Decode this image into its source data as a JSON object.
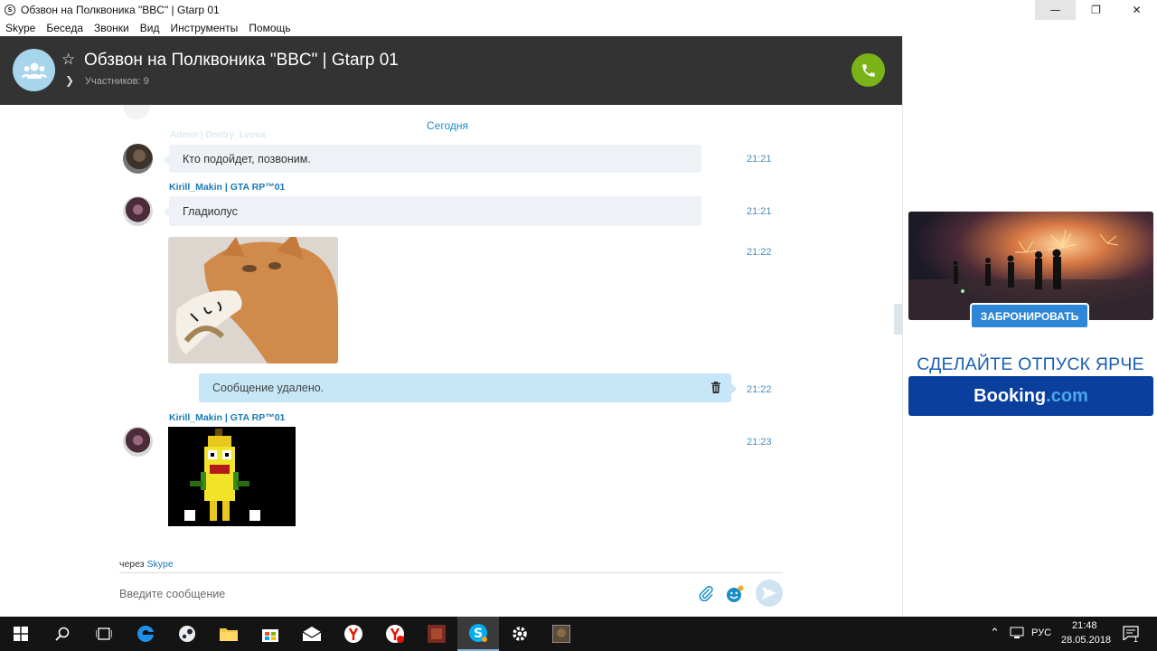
{
  "window": {
    "title": "Обзвон на Полквоника \"BBC\" | Gtarp 01"
  },
  "menu": [
    "Skype",
    "Беседа",
    "Звонки",
    "Вид",
    "Инструменты",
    "Помощь"
  ],
  "conversation": {
    "title": "Обзвон на Полквоника \"BBC\" | Gtarp 01",
    "participants": "Участников: 9"
  },
  "chat": {
    "faded_sender": "Admin | Dmitry_Lvova",
    "date_divider": "Сегодня",
    "messages": [
      {
        "text": "Кто подойдет, позвоним.",
        "time": "21:21"
      },
      {
        "sender": "Kirill_Makin | GTA RP™01",
        "text": "Гладиолус",
        "time": "21:21"
      },
      {
        "time": "21:22"
      },
      {
        "text": "Сообщение удалено.",
        "time": "21:22"
      },
      {
        "sender": "Kirill_Makin | GTA RP™01",
        "time": "21:23"
      }
    ],
    "via_label": "через",
    "via_app": "Skype",
    "input_placeholder": "Введите сообщение"
  },
  "ad": {
    "button": "ЗАБРОНИРОВАТЬ",
    "headline": "СДЕЛАЙТЕ ОТПУСК ЯРЧЕ",
    "brand_main": "Booking",
    "brand_dot": ".com"
  },
  "taskbar": {
    "language": "РУС",
    "time": "21:48",
    "date": "28.05.2018",
    "notifications": "1"
  },
  "colors": {
    "header_bg": "#333333",
    "call_green": "#7ab317",
    "accent_blue": "#1a8dc8",
    "bubble_gray": "#eef1f5",
    "bubble_mine": "#c7e7f8",
    "booking_blue": "#0a3f9d"
  }
}
